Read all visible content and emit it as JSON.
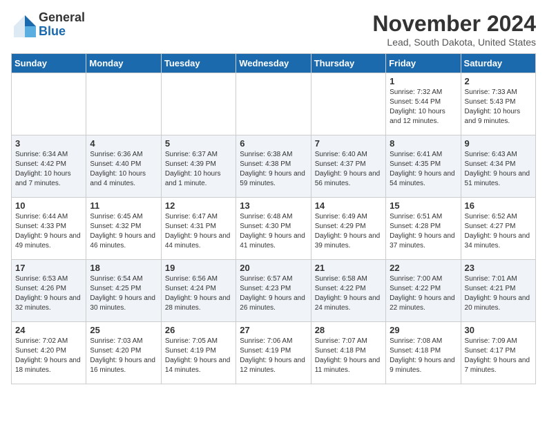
{
  "logo": {
    "general": "General",
    "blue": "Blue"
  },
  "title": "November 2024",
  "location": "Lead, South Dakota, United States",
  "weekdays": [
    "Sunday",
    "Monday",
    "Tuesday",
    "Wednesday",
    "Thursday",
    "Friday",
    "Saturday"
  ],
  "weeks": [
    [
      {
        "day": "",
        "info": ""
      },
      {
        "day": "",
        "info": ""
      },
      {
        "day": "",
        "info": ""
      },
      {
        "day": "",
        "info": ""
      },
      {
        "day": "",
        "info": ""
      },
      {
        "day": "1",
        "info": "Sunrise: 7:32 AM\nSunset: 5:44 PM\nDaylight: 10 hours and 12 minutes."
      },
      {
        "day": "2",
        "info": "Sunrise: 7:33 AM\nSunset: 5:43 PM\nDaylight: 10 hours and 9 minutes."
      }
    ],
    [
      {
        "day": "3",
        "info": "Sunrise: 6:34 AM\nSunset: 4:42 PM\nDaylight: 10 hours and 7 minutes."
      },
      {
        "day": "4",
        "info": "Sunrise: 6:36 AM\nSunset: 4:40 PM\nDaylight: 10 hours and 4 minutes."
      },
      {
        "day": "5",
        "info": "Sunrise: 6:37 AM\nSunset: 4:39 PM\nDaylight: 10 hours and 1 minute."
      },
      {
        "day": "6",
        "info": "Sunrise: 6:38 AM\nSunset: 4:38 PM\nDaylight: 9 hours and 59 minutes."
      },
      {
        "day": "7",
        "info": "Sunrise: 6:40 AM\nSunset: 4:37 PM\nDaylight: 9 hours and 56 minutes."
      },
      {
        "day": "8",
        "info": "Sunrise: 6:41 AM\nSunset: 4:35 PM\nDaylight: 9 hours and 54 minutes."
      },
      {
        "day": "9",
        "info": "Sunrise: 6:43 AM\nSunset: 4:34 PM\nDaylight: 9 hours and 51 minutes."
      }
    ],
    [
      {
        "day": "10",
        "info": "Sunrise: 6:44 AM\nSunset: 4:33 PM\nDaylight: 9 hours and 49 minutes."
      },
      {
        "day": "11",
        "info": "Sunrise: 6:45 AM\nSunset: 4:32 PM\nDaylight: 9 hours and 46 minutes."
      },
      {
        "day": "12",
        "info": "Sunrise: 6:47 AM\nSunset: 4:31 PM\nDaylight: 9 hours and 44 minutes."
      },
      {
        "day": "13",
        "info": "Sunrise: 6:48 AM\nSunset: 4:30 PM\nDaylight: 9 hours and 41 minutes."
      },
      {
        "day": "14",
        "info": "Sunrise: 6:49 AM\nSunset: 4:29 PM\nDaylight: 9 hours and 39 minutes."
      },
      {
        "day": "15",
        "info": "Sunrise: 6:51 AM\nSunset: 4:28 PM\nDaylight: 9 hours and 37 minutes."
      },
      {
        "day": "16",
        "info": "Sunrise: 6:52 AM\nSunset: 4:27 PM\nDaylight: 9 hours and 34 minutes."
      }
    ],
    [
      {
        "day": "17",
        "info": "Sunrise: 6:53 AM\nSunset: 4:26 PM\nDaylight: 9 hours and 32 minutes."
      },
      {
        "day": "18",
        "info": "Sunrise: 6:54 AM\nSunset: 4:25 PM\nDaylight: 9 hours and 30 minutes."
      },
      {
        "day": "19",
        "info": "Sunrise: 6:56 AM\nSunset: 4:24 PM\nDaylight: 9 hours and 28 minutes."
      },
      {
        "day": "20",
        "info": "Sunrise: 6:57 AM\nSunset: 4:23 PM\nDaylight: 9 hours and 26 minutes."
      },
      {
        "day": "21",
        "info": "Sunrise: 6:58 AM\nSunset: 4:22 PM\nDaylight: 9 hours and 24 minutes."
      },
      {
        "day": "22",
        "info": "Sunrise: 7:00 AM\nSunset: 4:22 PM\nDaylight: 9 hours and 22 minutes."
      },
      {
        "day": "23",
        "info": "Sunrise: 7:01 AM\nSunset: 4:21 PM\nDaylight: 9 hours and 20 minutes."
      }
    ],
    [
      {
        "day": "24",
        "info": "Sunrise: 7:02 AM\nSunset: 4:20 PM\nDaylight: 9 hours and 18 minutes."
      },
      {
        "day": "25",
        "info": "Sunrise: 7:03 AM\nSunset: 4:20 PM\nDaylight: 9 hours and 16 minutes."
      },
      {
        "day": "26",
        "info": "Sunrise: 7:05 AM\nSunset: 4:19 PM\nDaylight: 9 hours and 14 minutes."
      },
      {
        "day": "27",
        "info": "Sunrise: 7:06 AM\nSunset: 4:19 PM\nDaylight: 9 hours and 12 minutes."
      },
      {
        "day": "28",
        "info": "Sunrise: 7:07 AM\nSunset: 4:18 PM\nDaylight: 9 hours and 11 minutes."
      },
      {
        "day": "29",
        "info": "Sunrise: 7:08 AM\nSunset: 4:18 PM\nDaylight: 9 hours and 9 minutes."
      },
      {
        "day": "30",
        "info": "Sunrise: 7:09 AM\nSunset: 4:17 PM\nDaylight: 9 hours and 7 minutes."
      }
    ]
  ]
}
